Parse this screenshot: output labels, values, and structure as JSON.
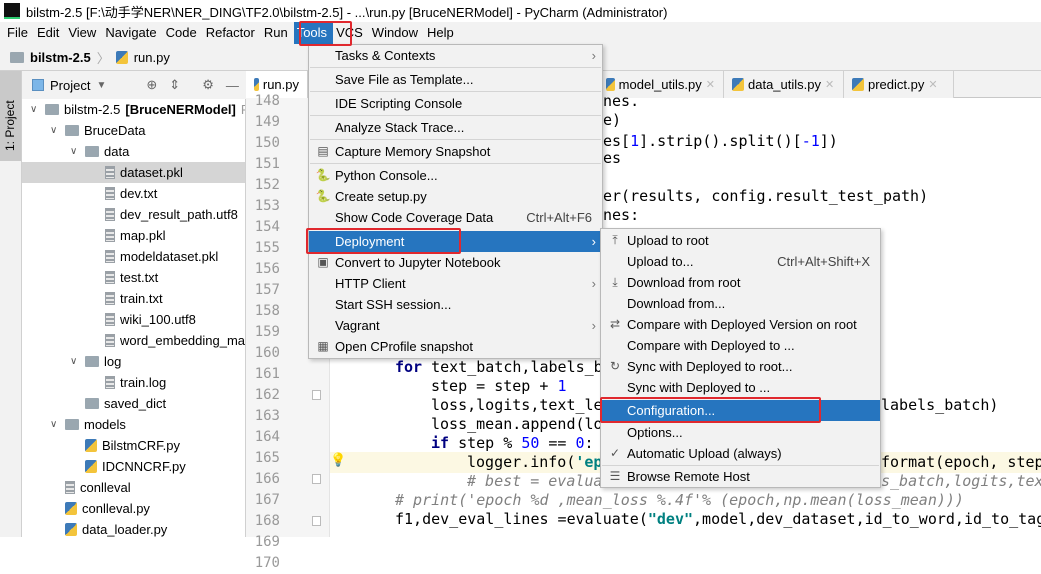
{
  "window": {
    "title": "bilstm-2.5 [F:\\动手学NER\\NER_DING\\TF2.0\\bilstm-2.5] - ...\\run.py [BruceNERModel] - PyCharm (Administrator)",
    "logo": "PC"
  },
  "menubar": [
    "File",
    "Edit",
    "View",
    "Navigate",
    "Code",
    "Refactor",
    "Run",
    "Tools",
    "VCS",
    "Window",
    "Help"
  ],
  "breadcrumb": {
    "project": "bilstm-2.5",
    "file": "run.py"
  },
  "side_strip": {
    "label": "1: Project"
  },
  "project_panel": {
    "title": "Project"
  },
  "tree": [
    {
      "label": "bilstm-2.5 ",
      "bold": "[BruceNERModel]",
      "suffix": " F:",
      "type": "folder",
      "depth": 0,
      "open": true
    },
    {
      "label": "BruceData",
      "type": "folder",
      "depth": 1,
      "open": true
    },
    {
      "label": "data",
      "type": "folder",
      "depth": 2,
      "open": true
    },
    {
      "label": "dataset.pkl",
      "type": "file",
      "depth": 3,
      "selected": true
    },
    {
      "label": "dev.txt",
      "type": "file",
      "depth": 3
    },
    {
      "label": "dev_result_path.utf8",
      "type": "file",
      "depth": 3
    },
    {
      "label": "map.pkl",
      "type": "file",
      "depth": 3
    },
    {
      "label": "modeldataset.pkl",
      "type": "file",
      "depth": 3
    },
    {
      "label": "test.txt",
      "type": "file",
      "depth": 3
    },
    {
      "label": "train.txt",
      "type": "file",
      "depth": 3
    },
    {
      "label": "wiki_100.utf8",
      "type": "file",
      "depth": 3
    },
    {
      "label": "word_embedding_ma",
      "type": "file",
      "depth": 3
    },
    {
      "label": "log",
      "type": "folder",
      "depth": 2,
      "open": true
    },
    {
      "label": "train.log",
      "type": "file",
      "depth": 3
    },
    {
      "label": "saved_dict",
      "type": "folder",
      "depth": 2
    },
    {
      "label": "models",
      "type": "folder",
      "depth": 1,
      "open": true
    },
    {
      "label": "BilstmCRF.py",
      "type": "py",
      "depth": 2
    },
    {
      "label": "IDCNNCRF.py",
      "type": "py",
      "depth": 2
    },
    {
      "label": "conlleval",
      "type": "file",
      "depth": 1
    },
    {
      "label": "conlleval.py",
      "type": "py",
      "depth": 1
    },
    {
      "label": "data_loader.py",
      "type": "py",
      "depth": 1
    }
  ],
  "editor_tabs": [
    "run.py",
    "model_utils.py",
    "data_utils.py",
    "predict.py"
  ],
  "line_numbers": [
    "148",
    "149",
    "150",
    "151",
    "152",
    "153",
    "154",
    "155",
    "156",
    "157",
    "158",
    "159",
    "160",
    "161",
    "162",
    "163",
    "164",
    "165",
    "166",
    "167",
    "168",
    "169",
    "170"
  ],
  "code": {
    "r148": "nes.",
    "r149": "e)",
    "r150a": "es[",
    "r150b": "1",
    "r150c": "].strip().split()[",
    "r150d": "-1",
    "r150e": "])",
    "r151": "es",
    "r153": "er(results, config.result_test_path)",
    "r154": "nes:",
    "l162kw": "for",
    "l162": " text_batch,labels_b",
    "l163": "step = step + ",
    "l163n": "1",
    "l164": "loss,logits,text_le",
    "r164": "labels_batch)",
    "l165": "loss_mean.append(lo",
    "l166kw": "if",
    "l166a": " step % ",
    "l166n": "50",
    "l166b": " == ",
    "l166n2": "0",
    "l166c": ":",
    "l167": "logger.info(",
    "l167s": "'ep",
    "r167": "format(epoch, step,",
    "l168": "# best = evalua",
    "r168": "s_batch,logits,tex",
    "l169": "# print('epoch %d ,mean_loss %.4f'% (epoch,np.mean(loss_mean)))",
    "l170a": "f1,dev_eval_lines =evaluate(",
    "l170s": "\"dev\"",
    "l170b": ",model,dev_dataset,id_to_word,id_to_tag"
  },
  "tools_menu": [
    {
      "label": "Tasks & Contexts",
      "submenu": true
    },
    {
      "label": "Save File as Template..."
    },
    {
      "label": "IDE Scripting Console"
    },
    {
      "label": "Analyze Stack Trace..."
    },
    {
      "label": "Capture Memory Snapshot",
      "icon": "memory-snapshot"
    },
    {
      "label": "Python Console...",
      "icon": "python"
    },
    {
      "label": "Create setup.py",
      "icon": "python"
    },
    {
      "label": "Show Code Coverage Data",
      "shortcut": "Ctrl+Alt+F6"
    },
    {
      "label": "Deployment",
      "submenu": true,
      "highlighted": true
    },
    {
      "label": "Convert to Jupyter Notebook",
      "icon": "ipython"
    },
    {
      "label": "HTTP Client",
      "submenu": true
    },
    {
      "label": "Start SSH session..."
    },
    {
      "label": "Vagrant",
      "submenu": true
    },
    {
      "label": "Open CProfile snapshot",
      "icon": "py-profile"
    }
  ],
  "deployment_menu": [
    {
      "label": "Upload to root",
      "icon": "upload"
    },
    {
      "label": "Upload to...",
      "shortcut": "Ctrl+Alt+Shift+X"
    },
    {
      "label": "Download from root",
      "icon": "download"
    },
    {
      "label": "Download from..."
    },
    {
      "label": "Compare with Deployed Version on root",
      "icon": "compare"
    },
    {
      "label": "Compare with Deployed to ..."
    },
    {
      "label": "Sync with Deployed to root...",
      "icon": "sync"
    },
    {
      "label": "Sync with Deployed to ..."
    },
    {
      "label": "Configuration...",
      "highlighted": true
    },
    {
      "label": "Options..."
    },
    {
      "label": "Automatic Upload (always)",
      "checked": true
    },
    {
      "label": "Browse Remote Host",
      "icon": "remote-host"
    }
  ],
  "colors": {
    "highlight": "#2675bf",
    "annotation_red": "#e0282e"
  }
}
